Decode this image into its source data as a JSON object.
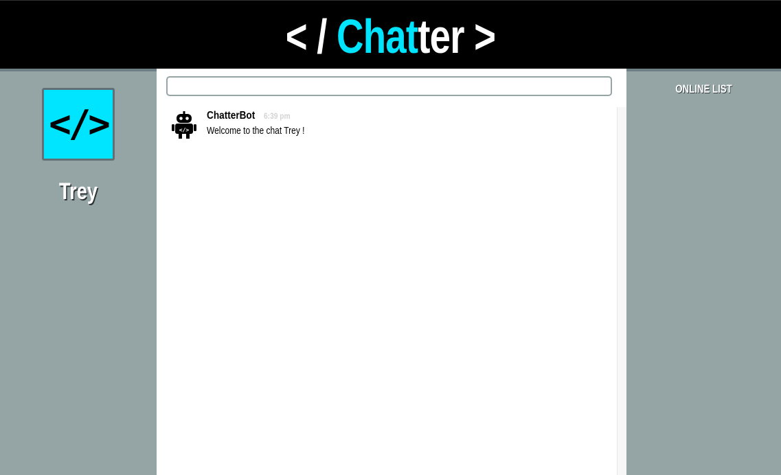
{
  "header": {
    "logo_open": "< / ",
    "logo_accent": "Chat",
    "logo_rest": "ter",
    "logo_close": " >",
    "accent_color": "#00e5ff",
    "background_color": "#000000"
  },
  "profile": {
    "avatar_icon": "code-brackets-icon",
    "avatar_glyph": "</>",
    "avatar_color": "#00e5ff",
    "username": "Trey"
  },
  "chat": {
    "input_value": "",
    "messages": [
      {
        "author": "ChatterBot",
        "time": "6:39 pm",
        "text": "Welcome to the chat Trey !",
        "avatar_icon": "robot-icon"
      }
    ]
  },
  "online_list": {
    "title": "ONLINE LIST",
    "users": []
  },
  "colors": {
    "side_panels": "#95a5a6",
    "chat_background": "#ffffff",
    "timestamp": "#d3d3d3"
  }
}
